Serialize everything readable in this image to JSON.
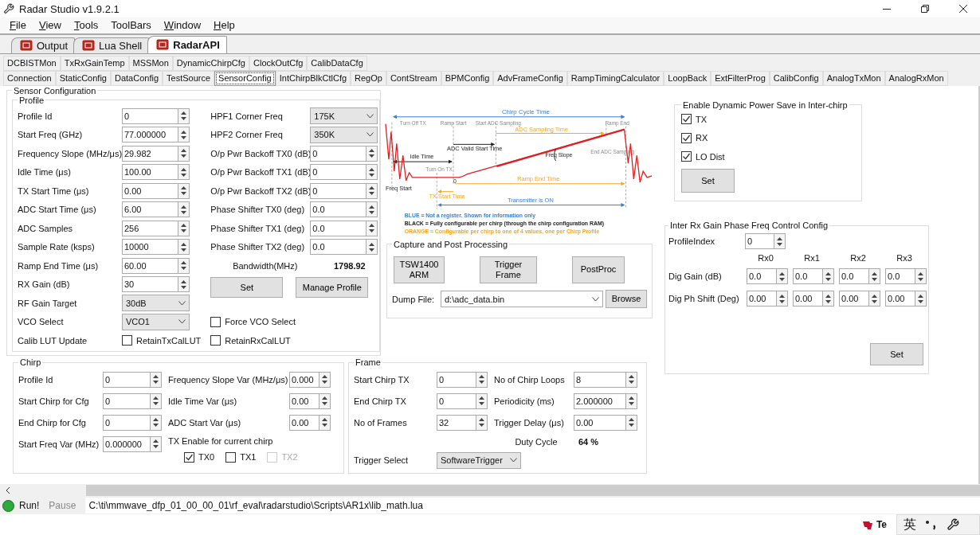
{
  "window": {
    "title": "Radar Studio v1.9.2.1"
  },
  "menu": [
    {
      "label": "File",
      "mnemonic": true
    },
    {
      "label": "View",
      "mnemonic": true
    },
    {
      "label": "Tools",
      "mnemonic": true
    },
    {
      "label": "ToolBars",
      "mnemonic": false
    },
    {
      "label": "Window",
      "mnemonic": true
    },
    {
      "label": "Help",
      "mnemonic": true
    }
  ],
  "doc_tabs": [
    {
      "label": "Output",
      "selected": false
    },
    {
      "label": "Lua Shell",
      "selected": false
    },
    {
      "label": "RadarAPI",
      "selected": true
    }
  ],
  "api_tab_rows": [
    {
      "tabs": [
        {
          "label": "DCBISTMon",
          "selected": false
        },
        {
          "label": "TxRxGainTemp",
          "selected": false
        },
        {
          "label": "MSSMon",
          "selected": false
        },
        {
          "label": "DynamicChirpCfg",
          "selected": false
        },
        {
          "label": "ClockOutCfg",
          "selected": false
        },
        {
          "label": "CalibDataCfg",
          "selected": false
        }
      ]
    },
    {
      "tabs": [
        {
          "label": "Connection",
          "selected": false
        },
        {
          "label": "StaticConfig",
          "selected": false
        },
        {
          "label": "DataConfig",
          "selected": false
        },
        {
          "label": "TestSource",
          "selected": false
        },
        {
          "label": "SensorConfig",
          "selected": true
        },
        {
          "label": "IntChirpBlkCtlCfg",
          "selected": false
        },
        {
          "label": "RegOp",
          "selected": false
        },
        {
          "label": "ContStream",
          "selected": false
        },
        {
          "label": "BPMConfig",
          "selected": false
        },
        {
          "label": "AdvFrameConfig",
          "selected": false
        },
        {
          "label": "RampTimingCalculator",
          "selected": false
        },
        {
          "label": "LoopBack",
          "selected": false
        },
        {
          "label": "ExtFilterProg",
          "selected": false
        },
        {
          "label": "CalibConfig",
          "selected": false
        },
        {
          "label": "AnalogTxMon",
          "selected": false
        },
        {
          "label": "AnalogRxMon",
          "selected": false
        }
      ]
    }
  ],
  "sensor_config": {
    "title": "Sensor Configuration",
    "profile": {
      "title": "Profile",
      "left_fields": [
        {
          "label": "Profile Id",
          "value": "0",
          "kind": "spin"
        },
        {
          "label": "Start Freq (GHz)",
          "value": "77.000000",
          "kind": "spin"
        },
        {
          "label": "Frequency Slope (MHz/μs)",
          "value": "29.982",
          "kind": "spin"
        },
        {
          "label": "Idle Time (μs)",
          "value": "100.00",
          "kind": "spin"
        },
        {
          "label": "TX Start Time (μs)",
          "value": "0.00",
          "kind": "spin"
        },
        {
          "label": "ADC Start Time (μs)",
          "value": "6.00",
          "kind": "spin"
        },
        {
          "label": "ADC Samples",
          "value": "256",
          "kind": "spin"
        },
        {
          "label": "Sample Rate (ksps)",
          "value": "10000",
          "kind": "spin"
        },
        {
          "label": "Ramp End Time (μs)",
          "value": "60.00",
          "kind": "spin"
        },
        {
          "label": "RX Gain (dB)",
          "value": "30",
          "kind": "spin"
        },
        {
          "label": "RF Gain Target",
          "value": "30dB",
          "kind": "select"
        },
        {
          "label": "VCO Select",
          "value": "VCO1",
          "kind": "select"
        }
      ],
      "right_fields": [
        {
          "label": "HPF1 Corner Freq",
          "value": "175K",
          "kind": "select"
        },
        {
          "label": "HPF2 Corner Freq",
          "value": "350K",
          "kind": "select"
        },
        {
          "label": "O/p Pwr Backoff TX0 (dB)",
          "value": "0",
          "kind": "spin"
        },
        {
          "label": "O/p Pwr Backoff TX1 (dB)",
          "value": "0",
          "kind": "spin"
        },
        {
          "label": "O/p Pwr Backoff TX2 (dB)",
          "value": "0",
          "kind": "spin"
        },
        {
          "label": "Phase Shifter TX0 (deg)",
          "value": "0.0",
          "kind": "spin"
        },
        {
          "label": "Phase Shifter TX1 (deg)",
          "value": "0.0",
          "kind": "spin"
        },
        {
          "label": "Phase Shifter TX2 (deg)",
          "value": "0.0",
          "kind": "spin"
        }
      ],
      "bandwidth": {
        "label": "Bandwidth(MHz)",
        "value": "1798.92"
      },
      "buttons": [
        "Set",
        "Manage Profile"
      ],
      "force_vco": {
        "label": "Force VCO Select",
        "checked": false
      },
      "calib_lut": {
        "label": "Calib LUT Update",
        "options": [
          {
            "label": "RetainTxCalLUT",
            "checked": false
          },
          {
            "label": "RetainRxCalLUT",
            "checked": false
          }
        ]
      }
    }
  },
  "diagram": {
    "labels": {
      "chirp_cycle_time": "Chirp Cycle Time",
      "turn_off_tx": "Turn Off TX",
      "ramp_start": "Ramp Start",
      "start_adc_sampling": "Start ADC Sampling",
      "ramp_end": "Ramp End",
      "adc_sampling_time": "ADC Sampling Time",
      "end_adc_sampling": "End ADC Sampling",
      "adc_valid_start_time": "ADC Valid Start Time",
      "idle_time": "Idle Time",
      "freq_slope": "Freq Slope",
      "turn_on_tx": "Turn On TX",
      "zero": "0",
      "freq_start": "Freq Start",
      "ramp_end_time": "Ramp End Time",
      "tx_start_time": "TX Start Time",
      "transmitter_on": "Transmitter is ON"
    },
    "legend": [
      {
        "text": "BLUE = Not a register. Shown for information only",
        "color": "#3a7fd0"
      },
      {
        "text": "BLACK = Fully configurable per chirp (through the chirp configuration RAM)",
        "color": "#222222"
      },
      {
        "text": "ORANGE = Configurable per chirp to one of 4 values, one per Chirp Profile",
        "color": "#f5a623"
      }
    ]
  },
  "capture": {
    "title": "Capture and Post Processing",
    "buttons": [
      "TSW1400 ARM",
      "Trigger Frame",
      "PostProc"
    ],
    "dump_file": {
      "label": "Dump File:",
      "value": "d:\\adc_data.bin"
    },
    "browse": "Browse"
  },
  "dynamic_power_save": {
    "title": "Enable Dynamic Power Save in Inter-chirp",
    "options": [
      {
        "label": "TX",
        "checked": true
      },
      {
        "label": "RX",
        "checked": true
      },
      {
        "label": "LO Dist",
        "checked": true
      }
    ],
    "button": "Set"
  },
  "inter_rx": {
    "title": "Inter Rx Gain Phase Freq Control Config",
    "profile_index": {
      "label": "ProfileIndex",
      "value": "0"
    },
    "columns": [
      "Rx0",
      "Rx1",
      "Rx2",
      "Rx3"
    ],
    "rows": [
      {
        "label": "Dig Gain (dB)",
        "values": [
          "0.0",
          "0.0",
          "0.0",
          "0.0"
        ]
      },
      {
        "label": "Dig Ph Shift (Deg)",
        "values": [
          "0.00",
          "0.00",
          "0.00",
          "0.00"
        ]
      }
    ],
    "button": "Set"
  },
  "chirp": {
    "title": "Chirp",
    "left_fields": [
      {
        "label": "Profile Id",
        "value": "0"
      },
      {
        "label": "Start Chirp for Cfg",
        "value": "0"
      },
      {
        "label": "End Chirp for Cfg",
        "value": "0"
      },
      {
        "label": "Start Freq Var (MHz)",
        "value": "0.000000"
      }
    ],
    "right_fields": [
      {
        "label": "Frequency Slope Var (MHz/μs)",
        "value": "0.000"
      },
      {
        "label": "Idle Time Var (μs)",
        "value": "0.00"
      },
      {
        "label": "ADC Start Var (μs)",
        "value": "0.00"
      }
    ],
    "tx_enable": {
      "label": "TX Enable for current chirp",
      "options": [
        {
          "label": "TX0",
          "checked": true,
          "disabled": false
        },
        {
          "label": "TX1",
          "checked": false,
          "disabled": false
        },
        {
          "label": "TX2",
          "checked": false,
          "disabled": true
        }
      ]
    }
  },
  "frame": {
    "title": "Frame",
    "left_fields": [
      {
        "label": "Start Chirp TX",
        "value": "0"
      },
      {
        "label": "End Chirp TX",
        "value": "0"
      },
      {
        "label": "No of Frames",
        "value": "32"
      }
    ],
    "right_fields": [
      {
        "label": "No of Chirp Loops",
        "value": "8"
      },
      {
        "label": "Periodicity (ms)",
        "value": "2.000000"
      },
      {
        "label": "Trigger Delay (μs)",
        "value": "0.00"
      }
    ],
    "duty_cycle": {
      "label": "Duty Cycle",
      "value": "64 %"
    },
    "trigger_select": {
      "label": "Trigger Select",
      "value": "SoftwareTrigger"
    }
  },
  "status_bar": {
    "run": "Run!",
    "pause": {
      "label": "Pause",
      "disabled": true
    },
    "path": "C:\\ti\\mmwave_dfp_01_00_00_01\\rf_eval\\radarstudio\\Scripts\\AR1x\\lib_math.lua"
  },
  "taskbar": {
    "logo_text": "Te",
    "ime": "英"
  }
}
